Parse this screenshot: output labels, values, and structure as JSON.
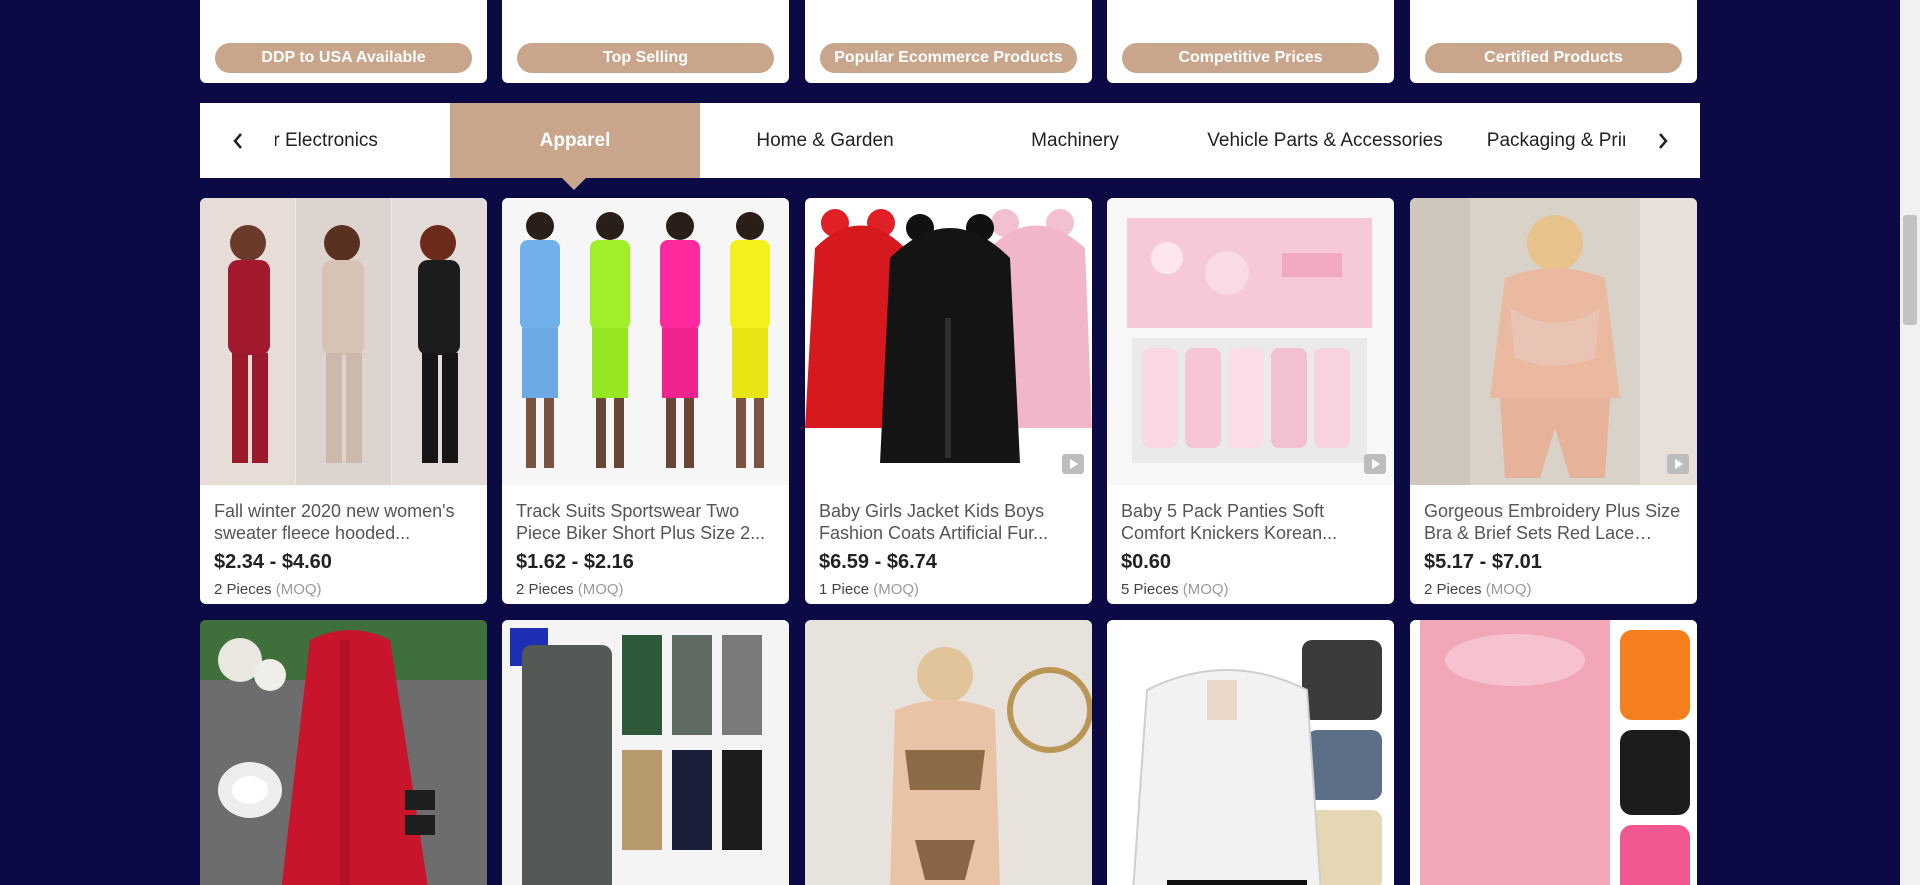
{
  "badges": [
    {
      "label": "DDP to USA Available"
    },
    {
      "label": "Top Selling"
    },
    {
      "label": "Popular Ecommerce Products"
    },
    {
      "label": "Competitive Prices"
    },
    {
      "label": "Certified Products"
    }
  ],
  "categories": {
    "items": [
      {
        "label": "Consumer Electronics"
      },
      {
        "label": "Apparel",
        "active": true
      },
      {
        "label": "Home & Garden"
      },
      {
        "label": "Machinery"
      },
      {
        "label": "Vehicle Parts & Accessories"
      },
      {
        "label": "Packaging & Printing"
      }
    ],
    "prev_icon": "chevron-left-icon",
    "next_icon": "chevron-right-icon"
  },
  "products": [
    {
      "title": "Fall winter 2020 new women's sweater fleece hooded...",
      "price": "$2.34 - $4.60",
      "moq_qty": "2 Pieces",
      "moq_tag": "(MOQ)",
      "video": false
    },
    {
      "title": "Track Suits Sportswear Two Piece Biker Short Plus Size 2...",
      "price": "$1.62 - $2.16",
      "moq_qty": "2 Pieces",
      "moq_tag": "(MOQ)",
      "video": false
    },
    {
      "title": "Baby Girls Jacket Kids Boys Fashion Coats Artificial Fur...",
      "price": "$6.59 - $6.74",
      "moq_qty": "1 Piece",
      "moq_tag": "(MOQ)",
      "video": true
    },
    {
      "title": "Baby 5 Pack Panties Soft Comfort Knickers Korean...",
      "price": "$0.60",
      "moq_qty": "5 Pieces",
      "moq_tag": "(MOQ)",
      "video": true
    },
    {
      "title": "Gorgeous Embroidery Plus Size Bra & Brief Sets Red Lace Stra...",
      "price": "$5.17 - $7.01",
      "moq_qty": "2 Pieces",
      "moq_tag": "(MOQ)",
      "video": true
    }
  ],
  "colors": {
    "background": "#0b0a45",
    "accent": "#c8a58b"
  }
}
